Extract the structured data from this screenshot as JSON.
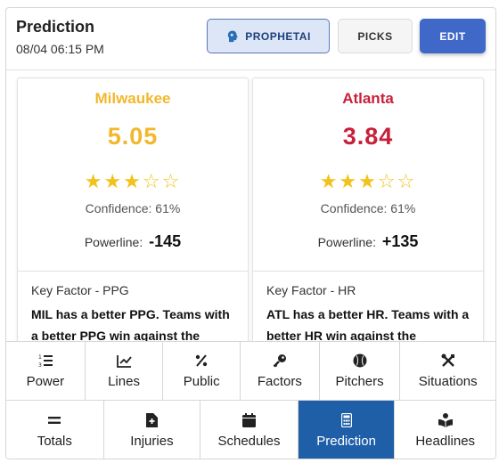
{
  "header": {
    "title": "Prediction",
    "datetime": "08/04 06:15 PM",
    "buttons": {
      "prophet": "PROPHETAI",
      "picks": "PICKS",
      "edit": "EDIT"
    }
  },
  "teams": [
    {
      "name": "Milwaukee",
      "color": "#f3b72b",
      "score": "5.05",
      "stars": "★★★☆☆",
      "rating": 3,
      "confidence": "Confidence: 61%",
      "powerline_label": "Powerline:",
      "powerline_value": "-145",
      "key_factor_title": "Key Factor - PPG",
      "key_factor_text": "MIL has a better PPG. Teams with a better PPG win against the"
    },
    {
      "name": "Atlanta",
      "color": "#c8203a",
      "score": "3.84",
      "stars": "★★★☆☆",
      "rating": 3,
      "confidence": "Confidence: 61%",
      "powerline_label": "Powerline:",
      "powerline_value": "+135",
      "key_factor_title": "Key Factor - HR",
      "key_factor_text": "ATL has a better HR. Teams with a better HR win against the"
    }
  ],
  "nav": {
    "row1": [
      {
        "label": "Power",
        "icon": "ordered-list-icon"
      },
      {
        "label": "Lines",
        "icon": "line-chart-icon"
      },
      {
        "label": "Public",
        "icon": "percent-icon"
      },
      {
        "label": "Factors",
        "icon": "key-icon"
      },
      {
        "label": "Pitchers",
        "icon": "baseball-icon"
      },
      {
        "label": "Situations",
        "icon": "tools-icon"
      }
    ],
    "row2": [
      {
        "label": "Totals",
        "icon": "equals-icon"
      },
      {
        "label": "Injuries",
        "icon": "medical-file-icon"
      },
      {
        "label": "Schedules",
        "icon": "calendar-icon"
      },
      {
        "label": "Prediction",
        "icon": "calculator-icon",
        "active": true
      },
      {
        "label": "Headlines",
        "icon": "book-reader-icon"
      }
    ]
  },
  "colors": {
    "accent": "#1f5fa8",
    "edit_button": "#3f68c8",
    "star": "#f2c21b"
  }
}
